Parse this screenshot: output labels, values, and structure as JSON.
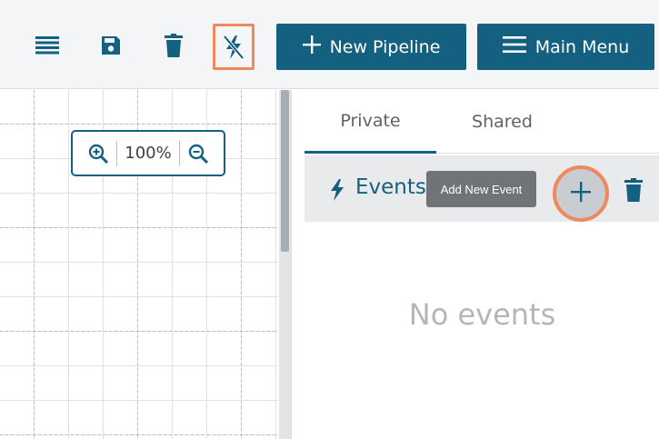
{
  "toolbar": {
    "icons": [
      "list-icon",
      "save-icon",
      "trash-icon",
      "disable-flow-icon"
    ],
    "new_pipeline_label": "New Pipeline",
    "main_menu_label": "Main Menu"
  },
  "canvas": {
    "zoom_value": "100%",
    "zoom_in_icon": "zoom-in-icon",
    "zoom_out_icon": "zoom-out-icon"
  },
  "panel": {
    "tabs": [
      {
        "label": "Private",
        "active": true
      },
      {
        "label": "Shared",
        "active": false
      }
    ],
    "events": {
      "label": "Events",
      "tooltip": "Add New Event",
      "add_icon": "plus-icon",
      "delete_icon": "trash-icon"
    },
    "empty_message": "No events"
  },
  "colors": {
    "primary": "#146080",
    "highlight": "#ec8a5e",
    "toolbar_bg": "#f4f5f6",
    "events_bar_bg": "#e8eaec",
    "muted_text": "#b3b7bb"
  }
}
